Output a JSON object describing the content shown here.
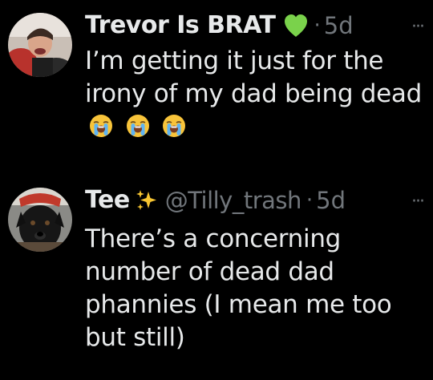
{
  "tweets": [
    {
      "display_name": "Trevor Is BRAT",
      "name_badge_icon": "green-heart-icon",
      "handle": "",
      "separator": "·",
      "time": "5d",
      "more_label": "···",
      "text": "I’m getting it just for the irony of my dad being dead",
      "trailing_emojis": [
        "loudly-crying-face-icon",
        "loudly-crying-face-icon",
        "loudly-crying-face-icon"
      ]
    },
    {
      "display_name": "Tee",
      "name_badge_icon": "sparkles-icon",
      "handle": "@Tilly_trash",
      "separator": "·",
      "time": "5d",
      "more_label": "···",
      "text": "There’s a concerning number of dead dad phannies (I mean me too but still)"
    }
  ],
  "colors": {
    "background": "#000000",
    "primary_text": "#e7e9ea",
    "secondary_text": "#71767b",
    "heart": "#7ad24b",
    "sparkle": "#f7c531"
  }
}
